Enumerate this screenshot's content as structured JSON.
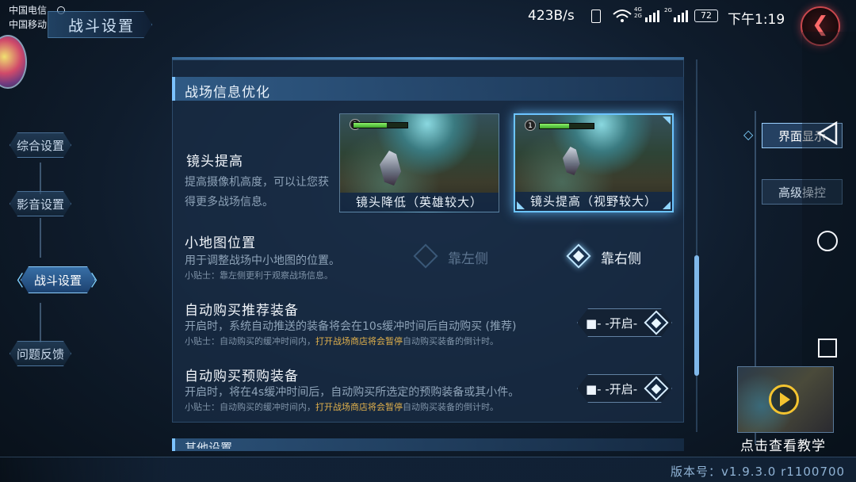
{
  "status_bar": {
    "carriers": [
      "中国电信",
      "中国移动"
    ],
    "net_speed": "423B/s",
    "network_badges": [
      "4G",
      "2G",
      "2G"
    ],
    "battery": "72",
    "time": "下午1:19"
  },
  "header": {
    "title": "战斗设置"
  },
  "left_nav": {
    "items": [
      {
        "label": "综合设置",
        "active": false
      },
      {
        "label": "影音设置",
        "active": false
      },
      {
        "label": "战斗设置",
        "active": true
      },
      {
        "label": "问题反馈",
        "active": false
      }
    ],
    "active_brackets": {
      "left": "〈",
      "right": "〉"
    }
  },
  "section": {
    "title": "战场信息优化",
    "next_title": "其他设置"
  },
  "camera": {
    "title": "镜头提高",
    "desc_line1": "提高摄像机高度，可以让您获",
    "desc_line2": "得更多战场信息。",
    "options": [
      {
        "caption": "镜头降低（英雄较大）",
        "selected": false,
        "level": "1",
        "hp": 0.62
      },
      {
        "caption": "镜头提高（视野较大）",
        "selected": true,
        "level": "1",
        "hp": 0.55
      }
    ]
  },
  "minimap": {
    "title": "小地图位置",
    "desc": "用于调整战场中小地图的位置。",
    "tip": "小贴士：靠左侧更利于观察战场信息。",
    "options": [
      {
        "label": "靠左侧",
        "selected": false
      },
      {
        "label": "靠右侧",
        "selected": true
      }
    ]
  },
  "auto_buy_recommended": {
    "title": "自动购买推荐装备",
    "desc": "开启时，系统自动推送的装备将会在10s缓冲时间后自动购买 (推荐)",
    "tip_before": "小贴士：自动购买的缓冲时间内，",
    "tip_highlight": "打开战场商店将会暂停",
    "tip_after": "自动购买装备的倒计时。",
    "toggle_label": "■- -开启-",
    "toggle_on": true
  },
  "auto_buy_preorder": {
    "title": "自动购买预购装备",
    "desc": "开启时，将在4s缓冲时间后，自动购买所选定的预购装备或其小件。",
    "tip_before": "小贴士：自动购买的缓冲时间内，",
    "tip_highlight": "打开战场商店将会暂停",
    "tip_after": "自动购买装备的倒计时。",
    "toggle_label": "■- -开启-",
    "toggle_on": true
  },
  "right_tabs": {
    "items": [
      {
        "label": "界面显示",
        "active": true
      },
      {
        "label": "高级操控",
        "active": false
      }
    ]
  },
  "video": {
    "label": "点击查看教学"
  },
  "footer": {
    "version": "版本号：v1.9.3.0 r1100700"
  },
  "colors": {
    "accent": "#6cc4ff",
    "highlight": "#e0b04c",
    "back_button": "#c9474d"
  }
}
